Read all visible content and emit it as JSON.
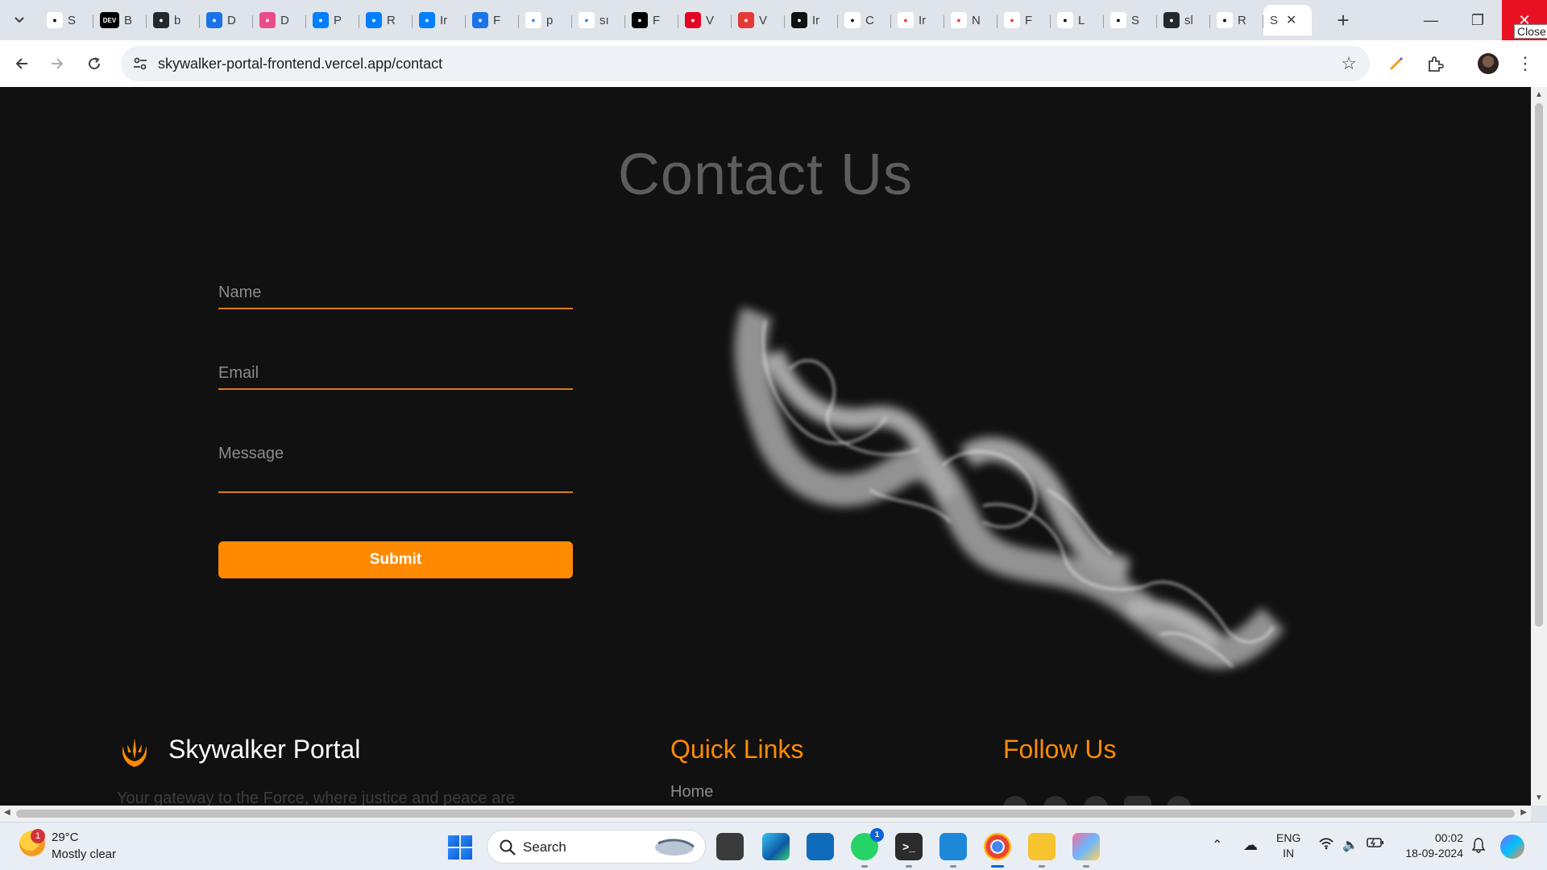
{
  "browser": {
    "tabs": [
      {
        "icon": "ycombinator-icon",
        "letter": "S",
        "color": "#ffffff",
        "fg": "#000"
      },
      {
        "icon": "dev-icon",
        "letter": "B",
        "color": "#000000",
        "fg": "#fff",
        "mark": "DEV"
      },
      {
        "icon": "github-icon",
        "letter": "b",
        "color": "#24292e",
        "fg": "#fff"
      },
      {
        "icon": "download-icon",
        "letter": "D",
        "color": "#1a73e8",
        "fg": "#fff"
      },
      {
        "icon": "dribbble-icon",
        "letter": "D",
        "color": "#ea4c89",
        "fg": "#fff"
      },
      {
        "icon": "mui-icon",
        "letter": "P",
        "color": "#007fff",
        "fg": "#fff"
      },
      {
        "icon": "mui-icon",
        "letter": "R",
        "color": "#007fff",
        "fg": "#fff"
      },
      {
        "icon": "mui-icon",
        "letter": "Ir",
        "color": "#007fff",
        "fg": "#fff"
      },
      {
        "icon": "flag-icon",
        "letter": "F",
        "color": "#1a73e8",
        "fg": "#fff"
      },
      {
        "icon": "google-icon",
        "letter": "p",
        "color": "#ffffff",
        "fg": "#4285f4"
      },
      {
        "icon": "google-icon",
        "letter": "sı",
        "color": "#ffffff",
        "fg": "#4285f4"
      },
      {
        "icon": "notion-icon",
        "letter": "F",
        "color": "#000000",
        "fg": "#fff"
      },
      {
        "icon": "pinterest-icon",
        "letter": "V",
        "color": "#e60023",
        "fg": "#fff"
      },
      {
        "icon": "g-icon",
        "letter": "V",
        "color": "#e53935",
        "fg": "#fff"
      },
      {
        "icon": "openai-icon",
        "letter": "Ir",
        "color": "#111111",
        "fg": "#fff"
      },
      {
        "icon": "openai-icon",
        "letter": "C",
        "color": "#ffffff",
        "fg": "#111"
      },
      {
        "icon": "gmail-icon",
        "letter": "Ir",
        "color": "#ffffff",
        "fg": "#ea4335"
      },
      {
        "icon": "gmail-icon",
        "letter": "N",
        "color": "#ffffff",
        "fg": "#ea4335"
      },
      {
        "icon": "gmail-icon",
        "letter": "F",
        "color": "#ffffff",
        "fg": "#ea4335"
      },
      {
        "icon": "lucide-icon",
        "letter": "L",
        "color": "#ffffff",
        "fg": "#000"
      },
      {
        "icon": "ycombinator-icon",
        "letter": "S",
        "color": "#ffffff",
        "fg": "#000"
      },
      {
        "icon": "github-icon",
        "letter": "sl",
        "color": "#24292e",
        "fg": "#fff"
      },
      {
        "icon": "link-icon",
        "letter": "R",
        "color": "#ffffff",
        "fg": "#000"
      }
    ],
    "active_tab": {
      "letter": "S",
      "close": "✕"
    },
    "new_tab": "+",
    "close_tooltip": "Close",
    "url": "skywalker-portal-frontend.vercel.app/contact"
  },
  "page": {
    "title": "Contact Us",
    "form": {
      "name_placeholder": "Name",
      "email_placeholder": "Email",
      "message_placeholder": "Message",
      "submit_label": "Submit"
    },
    "footer": {
      "brand": "Skywalker Portal",
      "tagline": "Your gateway to the Force, where justice and peace are",
      "quick_links_heading": "Quick Links",
      "quick_links": [
        "Home"
      ],
      "follow_heading": "Follow Us",
      "social": [
        "facebook-icon",
        "x-icon",
        "instagram-icon",
        "youtube-icon",
        "pinterest-icon"
      ]
    },
    "accent_color": "#ff8a00"
  },
  "taskbar": {
    "weather_temp": "29°C",
    "weather_desc": "Mostly clear",
    "weather_badge": "1",
    "search_label": "Search",
    "whatsapp_badge": "1",
    "lang_line1": "ENG",
    "lang_line2": "IN",
    "time": "00:02",
    "date": "18-09-2024"
  }
}
